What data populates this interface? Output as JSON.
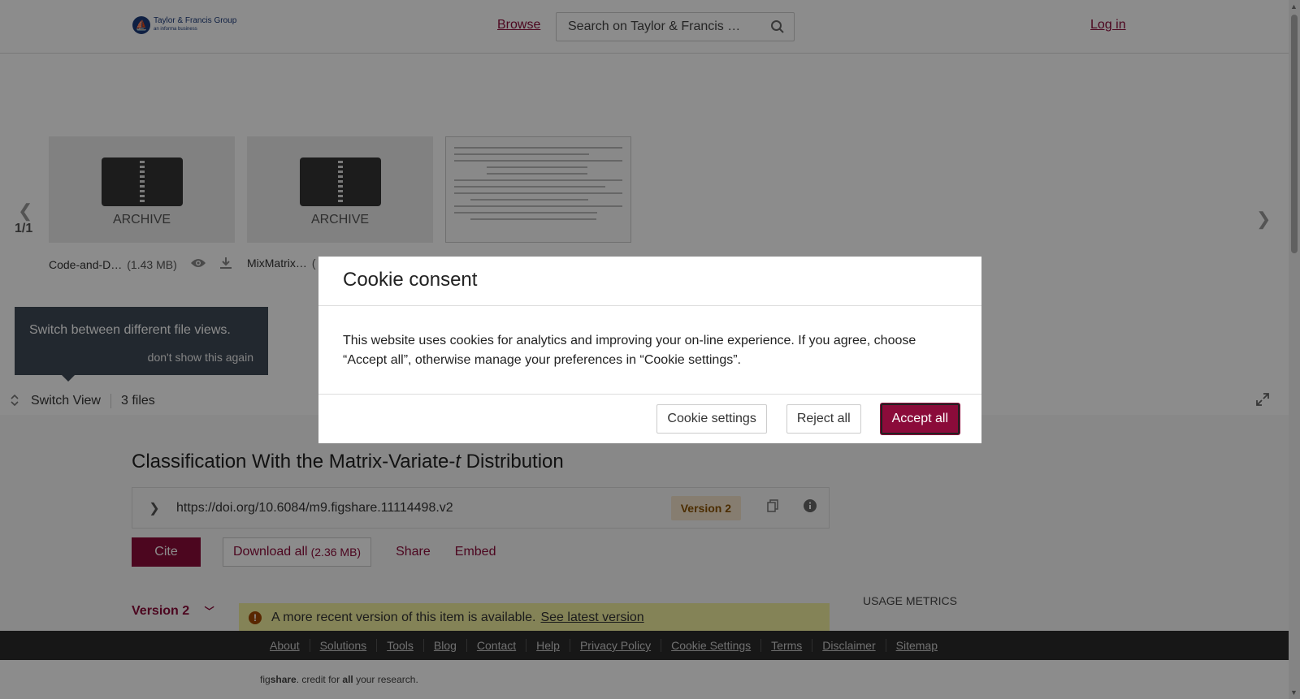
{
  "header": {
    "logo_main": "Taylor & Francis Group",
    "logo_sub": "an informa business",
    "browse": "Browse",
    "search_placeholder": "Search on Taylor & Francis …",
    "login": "Log in"
  },
  "preview": {
    "counter": "1/1",
    "cards": [
      {
        "label": "ARCHIVE",
        "name": "Code-and-D…",
        "size": "(1.43 MB)"
      },
      {
        "label": "ARCHIVE",
        "name": "MixMatrix…",
        "size": "("
      }
    ]
  },
  "tooltip": {
    "text": "Switch between different file views.",
    "dismiss": "don't show this again"
  },
  "switchbar": {
    "label": "Switch View",
    "files": "3 files"
  },
  "item": {
    "title_pre": "Classification With the Matrix-Variate-",
    "title_italic": "t",
    "title_post": " Distribution",
    "doi": "https://doi.org/10.6084/m9.figshare.11114498.v2",
    "version_badge": "Version 2",
    "cite": "Cite",
    "download": "Download all",
    "download_size": "(2.36 MB)",
    "share": "Share",
    "embed": "Embed",
    "version_toggle": "Version 2",
    "notice_text": "A more recent version of this item is available.",
    "notice_link": "See latest version",
    "usage": "USAGE METRICS"
  },
  "footer": {
    "links": [
      "About",
      "Solutions",
      "Tools",
      "Blog",
      "Contact",
      "Help",
      "Privacy Policy",
      "Cookie Settings",
      "Terms",
      "Disclaimer",
      "Sitemap"
    ],
    "tagline_pre": "fig",
    "tagline_bold": "share",
    "tagline_mid": ". credit for ",
    "tagline_all": "all",
    "tagline_post": " your research."
  },
  "cookie": {
    "title": "Cookie consent",
    "body": "This website uses cookies for analytics and improving your on-line experience. If you agree, choose “Accept all”, otherwise manage your preferences in “Cookie settings”.",
    "settings": "Cookie settings",
    "reject": "Reject all",
    "accept": "Accept all"
  },
  "colors": {
    "brand": "#8b0b3a",
    "footer": "#2b2b2b",
    "notice": "#f0ee9f"
  }
}
